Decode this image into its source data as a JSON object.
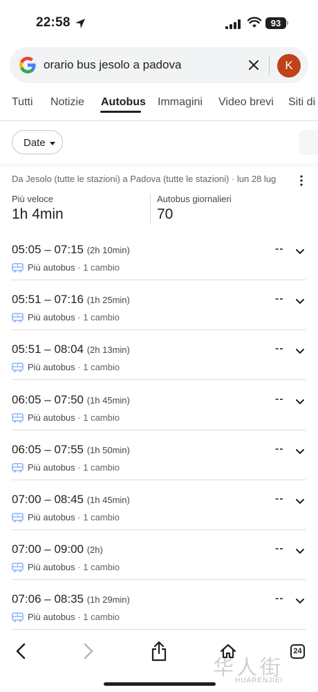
{
  "status_bar": {
    "time": "22:58",
    "battery": "93"
  },
  "search": {
    "query": "orario bus jesolo a padova",
    "avatar_letter": "K"
  },
  "tabs": [
    {
      "label": "Tutti"
    },
    {
      "label": "Notizie"
    },
    {
      "label": "Autobus"
    },
    {
      "label": "Immagini"
    },
    {
      "label": "Video brevi"
    },
    {
      "label": "Siti di"
    }
  ],
  "filters": {
    "date_label": "Date"
  },
  "route": {
    "summary": "Da Jesolo (tutte le stazioni) a Padova (tutte le stazioni) · lun 28 lug",
    "fastest_label": "Più veloce",
    "fastest_value": "1h 4min",
    "daily_label": "Autobus giornalieri",
    "daily_value": "70"
  },
  "trips": [
    {
      "times": "05:05 – 07:15",
      "duration": "(2h 10min)",
      "price": "--",
      "mode": "Più autobus",
      "changes": " · 1 cambio"
    },
    {
      "times": "05:51 – 07:16",
      "duration": "(1h 25min)",
      "price": "--",
      "mode": "Più autobus",
      "changes": " · 1 cambio"
    },
    {
      "times": "05:51 – 08:04",
      "duration": "(2h 13min)",
      "price": "--",
      "mode": "Più autobus",
      "changes": " · 1 cambio"
    },
    {
      "times": "06:05 – 07:50",
      "duration": "(1h 45min)",
      "price": "--",
      "mode": "Più autobus",
      "changes": " · 1 cambio"
    },
    {
      "times": "06:05 – 07:55",
      "duration": "(1h 50min)",
      "price": "--",
      "mode": "Più autobus",
      "changes": " · 1 cambio"
    },
    {
      "times": "07:00 – 08:45",
      "duration": "(1h 45min)",
      "price": "--",
      "mode": "Più autobus",
      "changes": " · 1 cambio"
    },
    {
      "times": "07:00 – 09:00",
      "duration": "(2h)",
      "price": "--",
      "mode": "Più autobus",
      "changes": " · 1 cambio"
    },
    {
      "times": "07:06 – 08:35",
      "duration": "(1h 29min)",
      "price": "--",
      "mode": "Più autobus",
      "changes": " · 1 cambio"
    }
  ],
  "toolbar": {
    "tabs_count": "24"
  },
  "watermark": {
    "text": "华人街",
    "sub": "HUARENJIEI"
  },
  "colors": {
    "bus_icon": "#8ab4f8",
    "avatar": "#c0411a",
    "text": "#1f1f1f"
  },
  "icons": [
    "location-arrow-icon",
    "signal-icon",
    "wifi-icon",
    "google-logo-icon",
    "close-icon",
    "chevron-down-icon",
    "bus-icon",
    "more-vert-icon",
    "back-icon",
    "forward-icon",
    "share-icon",
    "home-icon",
    "tabs-icon"
  ]
}
